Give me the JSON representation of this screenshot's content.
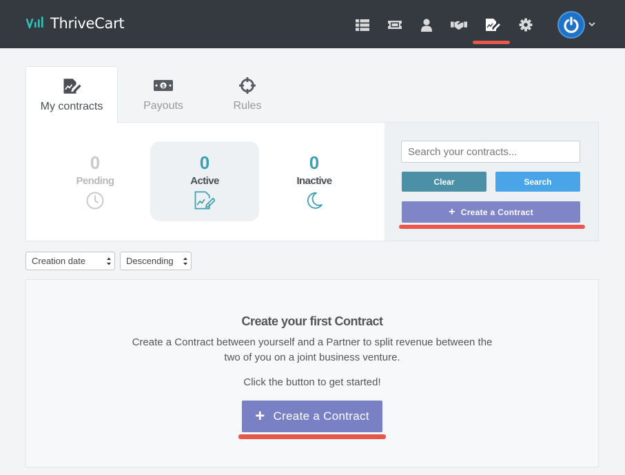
{
  "app": {
    "logo_text": "ThriveCart"
  },
  "topnav": {
    "icons": [
      "list-icon",
      "ticket-icon",
      "user-icon",
      "handshake-icon",
      "contract-edit-icon",
      "gear-icon"
    ],
    "active": "contract-edit-icon",
    "account_icon": "power-icon"
  },
  "tabs": [
    {
      "label": "My contracts",
      "icon": "contract-edit-icon",
      "active": true
    },
    {
      "label": "Payouts",
      "icon": "money-bill-icon",
      "active": false
    },
    {
      "label": "Rules",
      "icon": "crosshairs-icon",
      "active": false
    }
  ],
  "stats": [
    {
      "count": "0",
      "label": "Pending",
      "icon": "clock-icon",
      "color": "#c8cacc"
    },
    {
      "count": "0",
      "label": "Active",
      "icon": "contract-edit-icon",
      "color": "#3d9fb0"
    },
    {
      "count": "0",
      "label": "Inactive",
      "icon": "moon-icon",
      "color": "#3d9fb0"
    }
  ],
  "search": {
    "placeholder": "Search your contracts...",
    "value": "",
    "clear_label": "Clear",
    "search_label": "Search",
    "create_label": "Create a Contract"
  },
  "sort": {
    "field": "Creation date",
    "order": "Descending"
  },
  "empty_state": {
    "title": "Create your first Contract",
    "description": "Create a Contract between yourself and a Partner to split revenue between the two of you on a joint business venture.",
    "cta_text": "Click the button to get started!",
    "button_label": "Create a Contract"
  },
  "colors": {
    "header_bg": "#353a40",
    "accent_teal": "#3d9fb0",
    "create_button": "#7a80c4",
    "clear_button": "#4b90a7",
    "search_button": "#4aa5e8",
    "highlight_underline": "#e8574b",
    "logo_mark": "#2ec4b6"
  }
}
